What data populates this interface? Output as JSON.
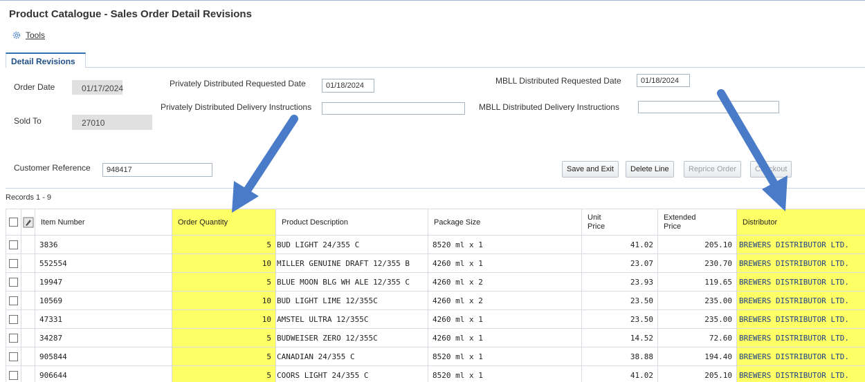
{
  "window": {
    "title": "Product Catalogue - Sales Order  Detail Revisions"
  },
  "toolbar": {
    "tools_label": "Tools",
    "tools_icon": "gear-icon"
  },
  "tabs": [
    {
      "label": "Detail Revisions",
      "active": true
    }
  ],
  "form": {
    "order_date_label": "Order Date",
    "order_date_value": "01/17/2024",
    "sold_to_label": "Sold To",
    "sold_to_value": "27010",
    "priv_req_date_label": "Privately Distributed Requested Date",
    "priv_req_date_value": "01/18/2024",
    "priv_delivery_label": "Privately Distributed Delivery Instructions",
    "priv_delivery_value": "",
    "mbll_req_date_label": "MBLL Distributed Requested Date",
    "mbll_req_date_value": "01/18/2024",
    "mbll_delivery_label": "MBLL Distributed Delivery Instructions",
    "mbll_delivery_value": "",
    "customer_ref_label": "Customer Reference",
    "customer_ref_value": "948417"
  },
  "buttons": {
    "save_exit": "Save and Exit",
    "delete_line": "Delete Line",
    "reprice_order": "Reprice Order",
    "checkout": "Checkout"
  },
  "grid": {
    "records_label": "Records 1 - 9",
    "headers": {
      "item_number": "Item Number",
      "order_quantity": "Order Quantity",
      "product_description": "Product Description",
      "package_size": "Package Size",
      "unit_price_1": "Unit",
      "unit_price_2": "Price",
      "extended_price_1": "Extended",
      "extended_price_2": "Price",
      "distributor": "Distributor"
    },
    "rows": [
      {
        "item": "3836",
        "qty": "5",
        "desc": "BUD LIGHT 24/355 C",
        "pkg": "8520 ml x 1",
        "unit": "41.02",
        "ext": "205.10",
        "dist": "BREWERS DISTRIBUTOR LTD."
      },
      {
        "item": "552554",
        "qty": "10",
        "desc": "MILLER GENUINE DRAFT 12/355 B",
        "pkg": "4260 ml x 1",
        "unit": "23.07",
        "ext": "230.70",
        "dist": "BREWERS DISTRIBUTOR LTD."
      },
      {
        "item": "19947",
        "qty": "5",
        "desc": "BLUE MOON BLG WH ALE 12/355 C",
        "pkg": "4260 ml x 2",
        "unit": "23.93",
        "ext": "119.65",
        "dist": "BREWERS DISTRIBUTOR LTD."
      },
      {
        "item": "10569",
        "qty": "10",
        "desc": "BUD LIGHT LIME 12/355C",
        "pkg": "4260 ml x 2",
        "unit": "23.50",
        "ext": "235.00",
        "dist": "BREWERS DISTRIBUTOR LTD."
      },
      {
        "item": "47331",
        "qty": "10",
        "desc": "AMSTEL ULTRA 12/355C",
        "pkg": "4260 ml x 1",
        "unit": "23.50",
        "ext": "235.00",
        "dist": "BREWERS DISTRIBUTOR LTD."
      },
      {
        "item": "34287",
        "qty": "5",
        "desc": "BUDWEISER ZERO 12/355C",
        "pkg": "4260 ml x 1",
        "unit": "14.52",
        "ext": "72.60",
        "dist": "BREWERS DISTRIBUTOR LTD."
      },
      {
        "item": "905844",
        "qty": "5",
        "desc": "CANADIAN 24/355 C",
        "pkg": "8520 ml x 1",
        "unit": "38.88",
        "ext": "194.40",
        "dist": "BREWERS DISTRIBUTOR LTD."
      },
      {
        "item": "906644",
        "qty": "5",
        "desc": "COORS LIGHT 24/355 C",
        "pkg": "8520 ml x 1",
        "unit": "41.02",
        "ext": "205.10",
        "dist": "BREWERS DISTRIBUTOR LTD."
      }
    ]
  },
  "colors": {
    "highlight": "#ffff66",
    "arrow": "#4a7bc8",
    "tab_accent": "#2f6fb0"
  }
}
